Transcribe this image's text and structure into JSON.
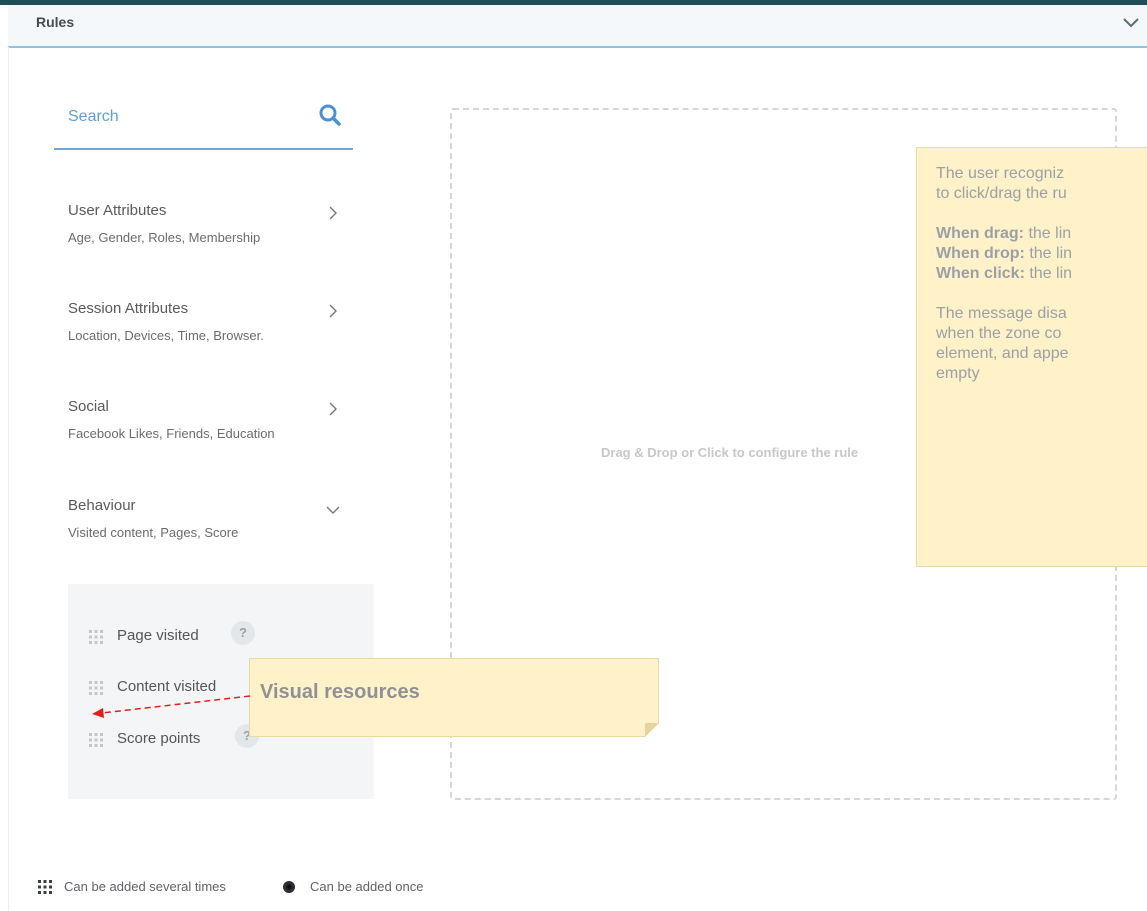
{
  "panel": {
    "title": "Rules"
  },
  "search": {
    "placeholder": "Search"
  },
  "categories": [
    {
      "title": "User Attributes",
      "subtitle": "Age, Gender, Roles, Membership",
      "expanded": false
    },
    {
      "title": "Session Attributes",
      "subtitle": "Location, Devices, Time, Browser.",
      "expanded": false
    },
    {
      "title": "Social",
      "subtitle": "Facebook Likes, Friends, Education",
      "expanded": false
    },
    {
      "title": "Behaviour",
      "subtitle": "Visited content, Pages, Score",
      "expanded": true
    }
  ],
  "behaviour_items": [
    {
      "label": "Page visited",
      "help": "?"
    },
    {
      "label": "Content visited",
      "help": "?"
    },
    {
      "label": "Score points",
      "help": "?"
    }
  ],
  "dropzone": {
    "text": "Drag & Drop or Click to configure the rule"
  },
  "note": {
    "intro1": "The user recogniz",
    "intro2": "to click/drag the ru",
    "drag_label": "When drag:",
    "drag_text": " the lin",
    "drop_label": "When drop:",
    "drop_text": " the lin",
    "click_label": "When click:",
    "click_text": " the lin",
    "msg1": "The message disa",
    "msg2": "when the zone co",
    "msg3": "element, and appe",
    "msg4": "empty"
  },
  "annotation": {
    "text": "Visual resources"
  },
  "legend": {
    "several": "Can be added several times",
    "once": "Can be added once"
  },
  "colors": {
    "accent": "#5d9fd3",
    "header_band": "#1f4e5a",
    "note_bg": "#fff2c8",
    "arrow": "#e0201a"
  },
  "icons": {
    "search": "search-icon",
    "chevron_right": "chevron-right-icon",
    "chevron_down": "chevron-down-icon",
    "drag_handle": "drag-handle-icon"
  }
}
